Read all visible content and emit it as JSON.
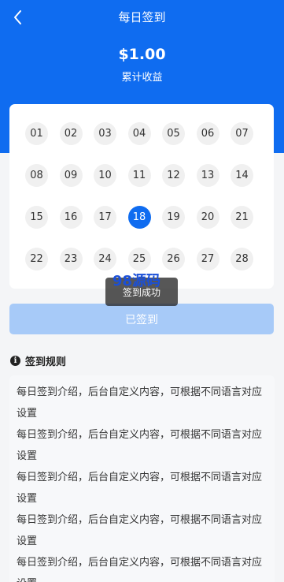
{
  "nav": {
    "title": "每日签到",
    "back_icon": "chevron-left-icon"
  },
  "summary": {
    "amount": "$1.00",
    "label": "累计收益"
  },
  "calendar": {
    "days": [
      "01",
      "02",
      "03",
      "04",
      "05",
      "06",
      "07",
      "08",
      "09",
      "10",
      "11",
      "12",
      "13",
      "14",
      "15",
      "16",
      "17",
      "18",
      "19",
      "20",
      "21",
      "22",
      "23",
      "24",
      "25",
      "26",
      "27",
      "28"
    ],
    "active_day": "18"
  },
  "toast": {
    "text": "签到成功"
  },
  "watermark": {
    "text": "98源码"
  },
  "sign_button": {
    "label": "已签到"
  },
  "rules": {
    "title": "签到规则",
    "icon": "info-icon",
    "lines": [
      "每日签到介绍，后台自定义内容，可根据不同语言对应设置",
      "每日签到介绍，后台自定义内容，可根据不同语言对应设置",
      "每日签到介绍，后台自定义内容，可根据不同语言对应设置",
      "每日签到介绍，后台自定义内容，可根据不同语言对应设置",
      "每日签到介绍，后台自定义内容，可根据不同语言对应设置"
    ]
  },
  "colors": {
    "primary": "#0f6cf0",
    "button_disabled": "#a7caf8",
    "day_bg": "#f0f0f0"
  }
}
